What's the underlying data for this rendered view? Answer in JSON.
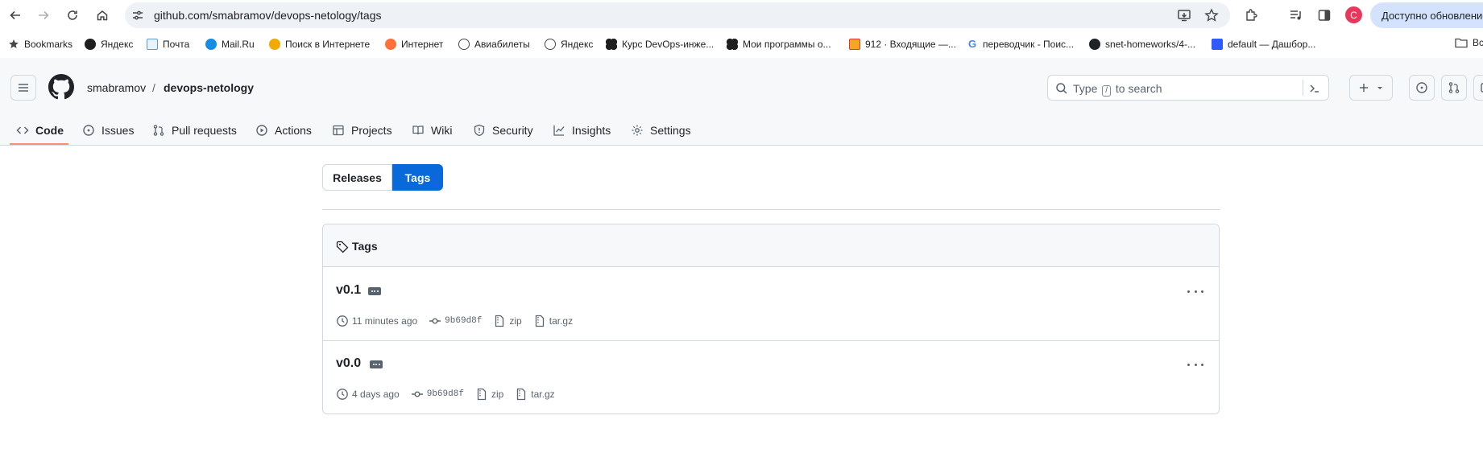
{
  "browser": {
    "url": "github.com/smabramov/devops-netology/tags",
    "profile_initial": "C",
    "update_label": "Доступно обновление",
    "bookmarks": [
      {
        "label": "Bookmarks",
        "icon": "star-icon",
        "color": "#474747"
      },
      {
        "label": "Яндекс",
        "icon": "yandex-icon",
        "color": "#1f1f1f"
      },
      {
        "label": "Почта",
        "icon": "mail-icon",
        "color": "#5b9bd5"
      },
      {
        "label": "Mail.Ru",
        "icon": "mailru-icon",
        "color": "#168de2"
      },
      {
        "label": "Поиск в Интернете",
        "icon": "search-key-icon",
        "color": "#f2a900"
      },
      {
        "label": "Интернет",
        "icon": "firefox-icon",
        "color": "#ff7139"
      },
      {
        "label": "Авиабилеты",
        "icon": "globe-icon",
        "color": "#474747"
      },
      {
        "label": "Яндекс",
        "icon": "globe-icon",
        "color": "#474747"
      },
      {
        "label": "Курс DevOps-инже...",
        "icon": "netology-icon",
        "color": "#1f1f1f"
      },
      {
        "label": "Мои программы о...",
        "icon": "netology-icon",
        "color": "#1f1f1f"
      },
      {
        "label": "912 · Входящие —...",
        "icon": "yandex-mail-icon",
        "color": "#f5a623"
      },
      {
        "label": "переводчик - Поис...",
        "icon": "google-icon",
        "color": "#4285f4"
      },
      {
        "label": "snet-homeworks/4-...",
        "icon": "github-icon",
        "color": "#1f2328"
      },
      {
        "label": "default — Дашбор...",
        "icon": "yandex-cloud-icon",
        "color": "#2e5bff"
      }
    ],
    "folder_label": "Вс"
  },
  "github": {
    "owner": "smabramov",
    "separator": "/",
    "repo": "devops-netology",
    "search": {
      "prefix": "Type",
      "key": "/",
      "suffix": "to search"
    },
    "tabs": [
      {
        "label": "Code",
        "icon": "code-icon"
      },
      {
        "label": "Issues",
        "icon": "issue-icon"
      },
      {
        "label": "Pull requests",
        "icon": "pull-request-icon"
      },
      {
        "label": "Actions",
        "icon": "actions-icon"
      },
      {
        "label": "Projects",
        "icon": "table-icon"
      },
      {
        "label": "Wiki",
        "icon": "book-icon"
      },
      {
        "label": "Security",
        "icon": "shield-icon"
      },
      {
        "label": "Insights",
        "icon": "graph-icon"
      },
      {
        "label": "Settings",
        "icon": "gear-icon"
      }
    ],
    "subnav": {
      "releases": "Releases",
      "tags": "Tags"
    },
    "tags_box": {
      "title": "Tags",
      "rows": [
        {
          "name": "v0.1",
          "time": "11 minutes ago",
          "sha": "9b69d8f",
          "zip": "zip",
          "targz": "tar.gz"
        },
        {
          "name": "v0.0",
          "time": "4 days ago",
          "sha": "9b69d8f",
          "zip": "zip",
          "targz": "tar.gz"
        }
      ]
    }
  },
  "colors": {
    "accent": "#0969da",
    "tab_underline": "#fd8c73"
  }
}
